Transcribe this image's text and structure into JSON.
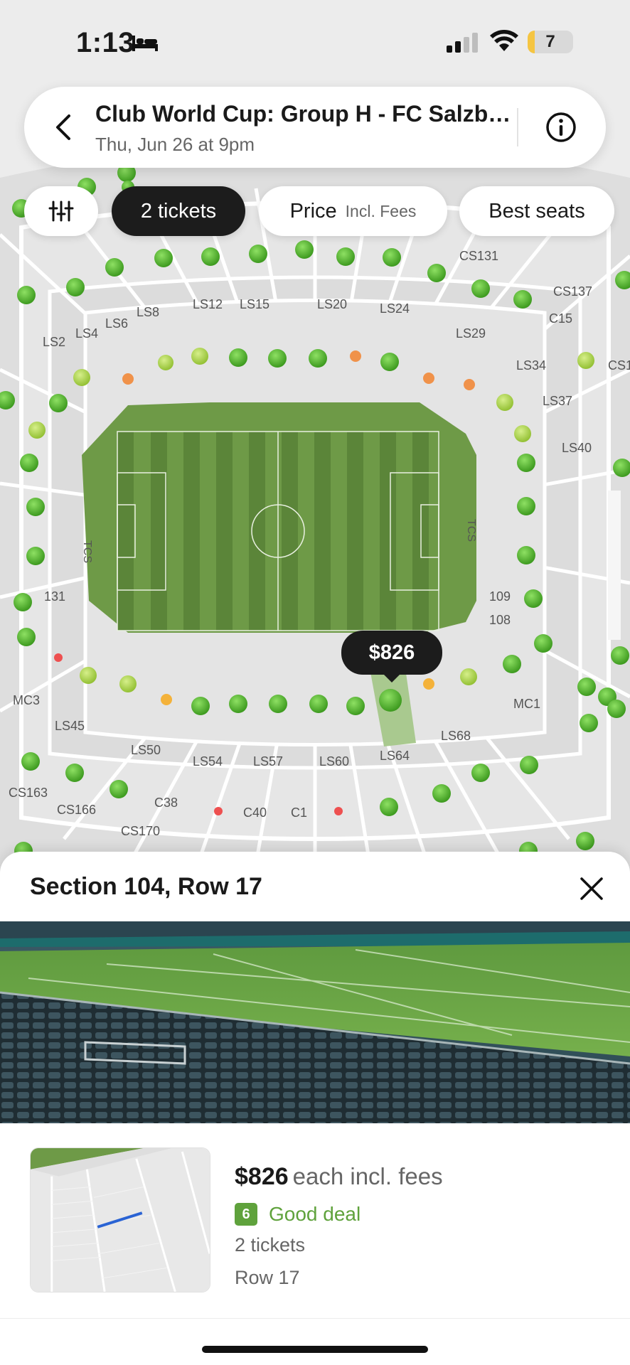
{
  "status": {
    "time": "1:13",
    "battery": "7"
  },
  "header": {
    "title": "Club World Cup: Group H - FC Salzburg vs Real Madrid",
    "subtitle": "Thu, Jun 26 at 9pm"
  },
  "filters": {
    "tickets_label": "2 tickets",
    "price_label": "Price",
    "price_sub": "Incl. Fees",
    "sort_label": "Best seats"
  },
  "map": {
    "selected_price": "$826",
    "section_labels": [
      "LS2",
      "LS4",
      "LS6",
      "LS8",
      "LS12",
      "LS15",
      "LS20",
      "LS24",
      "LS29",
      "LS34",
      "LS37",
      "LS40",
      "CS131",
      "CS137",
      "C15",
      "CS1",
      "LS45",
      "LS50",
      "LS54",
      "LS57",
      "LS60",
      "LS64",
      "LS68",
      "MC1",
      "MC3",
      "CS163",
      "CS166",
      "CS170",
      "C38",
      "C40",
      "C1",
      "131",
      "109",
      "108",
      "TCS",
      "TCS"
    ]
  },
  "sheet": {
    "title": "Section 104, Row 17",
    "price": "$826",
    "price_suffix": "each incl. fees",
    "deal_score": "6",
    "deal_label": "Good deal",
    "tickets": "2 tickets",
    "row": "Row 17"
  },
  "colors": {
    "field": "#6e9a47",
    "seat_dot": "#4caf24",
    "accent_dark": "#1c1c1c",
    "deal_green": "#5fa23c"
  }
}
